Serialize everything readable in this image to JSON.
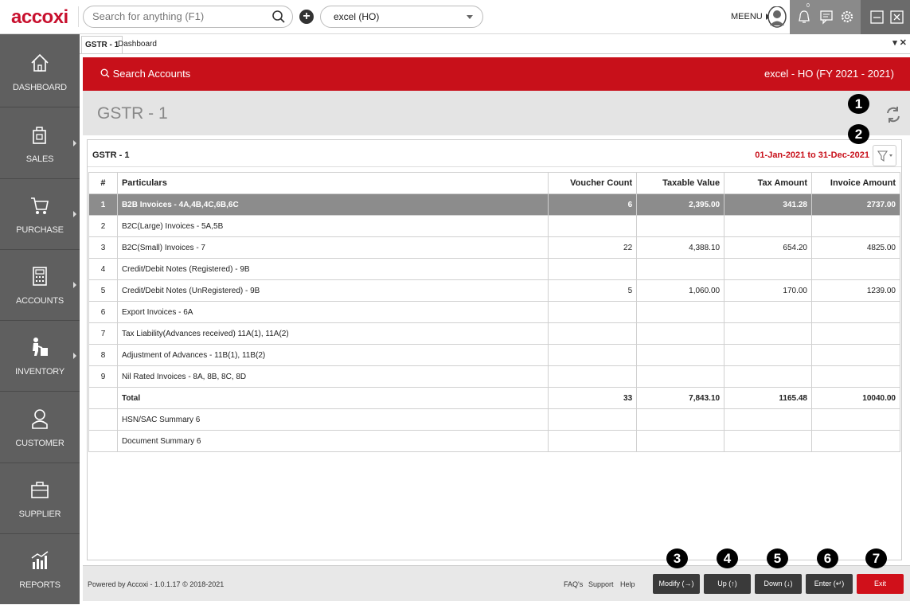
{
  "app": {
    "logo": "accoxi"
  },
  "topbar": {
    "search_placeholder": "Search for anything (F1)",
    "company": "excel (HO)",
    "menu_label": "MEENU",
    "notification_count": "0"
  },
  "sidebar": {
    "items": [
      {
        "label": "DASHBOARD"
      },
      {
        "label": "SALES"
      },
      {
        "label": "PURCHASE"
      },
      {
        "label": "ACCOUNTS"
      },
      {
        "label": "INVENTORY"
      },
      {
        "label": "CUSTOMER"
      },
      {
        "label": "SUPPLIER"
      },
      {
        "label": "REPORTS"
      }
    ]
  },
  "tabs": [
    {
      "label": "GSTR - 1"
    },
    {
      "label": "Dashboard"
    }
  ],
  "tab_controls": "▾ ✕",
  "header": {
    "search_accounts": "Search Accounts",
    "company_fy": "excel - HO (FY 2021 - 2021)",
    "page_title": "GSTR - 1"
  },
  "report": {
    "name": "GSTR - 1",
    "date_range": "01-Jan-2021 to 31-Dec-2021",
    "columns": [
      "#",
      "Particulars",
      "Voucher Count",
      "Taxable Value",
      "Tax Amount",
      "Invoice Amount"
    ],
    "rows": [
      [
        "1",
        "B2B Invoices - 4A,4B,4C,6B,6C",
        "6",
        "2,395.00",
        "341.28",
        "2737.00"
      ],
      [
        "2",
        "B2C(Large) Invoices - 5A,5B",
        "",
        "",
        "",
        ""
      ],
      [
        "3",
        "B2C(Small) Invoices - 7",
        "22",
        "4,388.10",
        "654.20",
        "4825.00"
      ],
      [
        "4",
        "Credit/Debit Notes (Registered) - 9B",
        "",
        "",
        "",
        ""
      ],
      [
        "5",
        "Credit/Debit Notes (UnRegistered) - 9B",
        "5",
        "1,060.00",
        "170.00",
        "1239.00"
      ],
      [
        "6",
        "Export Invoices - 6A",
        "",
        "",
        "",
        ""
      ],
      [
        "7",
        "Tax Liability(Advances received) 11A(1), 11A(2)",
        "",
        "",
        "",
        ""
      ],
      [
        "8",
        "Adjustment of Advances - 11B(1), 11B(2)",
        "",
        "",
        "",
        ""
      ],
      [
        "9",
        "Nil Rated Invoices - 8A, 8B, 8C, 8D",
        "",
        "",
        "",
        ""
      ],
      [
        "",
        "Total",
        "33",
        "7,843.10",
        "1165.48",
        "10040.00"
      ],
      [
        "",
        "HSN/SAC Summary 6",
        "",
        "",
        "",
        ""
      ],
      [
        "",
        "Document Summary 6",
        "",
        "",
        "",
        ""
      ]
    ]
  },
  "footer": {
    "powered": "Powered by Accoxi - 1.0.1.17 © 2018-2021",
    "faqs": "FAQ's",
    "support": "Support",
    "help": "Help",
    "buttons": {
      "modify": "Modify (→)",
      "up": "Up (↑)",
      "down": "Down (↓)",
      "enter": "Enter (↵)",
      "exit": "Exit"
    }
  },
  "badges": [
    "1",
    "2",
    "3",
    "4",
    "5",
    "6",
    "7"
  ],
  "colors": {
    "brand_red": "#c8101a",
    "sidebar": "#5f5f5f",
    "selected_row": "#8c8c8c"
  }
}
